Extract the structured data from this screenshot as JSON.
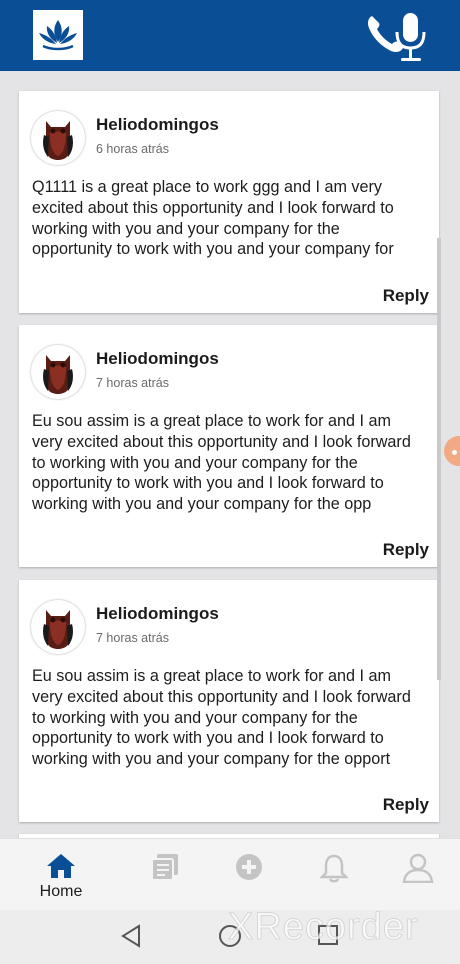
{
  "header": {
    "logo_icon": "lotus-icon",
    "mic_icon": "phone-mic-icon",
    "bar_color": "#0a4f95"
  },
  "posts": [
    {
      "author": "Heliodomingos",
      "time": "6 horas atrás",
      "text": "Q1111 is a great place to work ggg and I am very excited about this opportunity and I look forward to working with you and your company for the opportunity to work with you and your company for",
      "reply_label": "Reply"
    },
    {
      "author": "Heliodomingos",
      "time": "7 horas atrás",
      "text": "Eu sou assim is a great place to work for and I am very excited about this opportunity and I look forward to working with you and your company for the opportunity to work with you and I look forward to working with you and your company for the opp",
      "reply_label": "Reply"
    },
    {
      "author": "Heliodomingos",
      "time": "7 horas atrás",
      "text": "Eu sou assim is a great place to work for and I am very excited about this opportunity and I look forward to working with you and your company for the opportunity to work with you and I look forward to working with you and your company for the opport",
      "reply_label": "Reply"
    }
  ],
  "bottom_nav": {
    "home_label": "Home",
    "items": [
      "home-icon",
      "posts-icon",
      "add-icon",
      "bell-icon",
      "profile-icon"
    ],
    "active_color": "#0a4f95"
  },
  "system_nav": {
    "watermark": "XRecorder"
  }
}
